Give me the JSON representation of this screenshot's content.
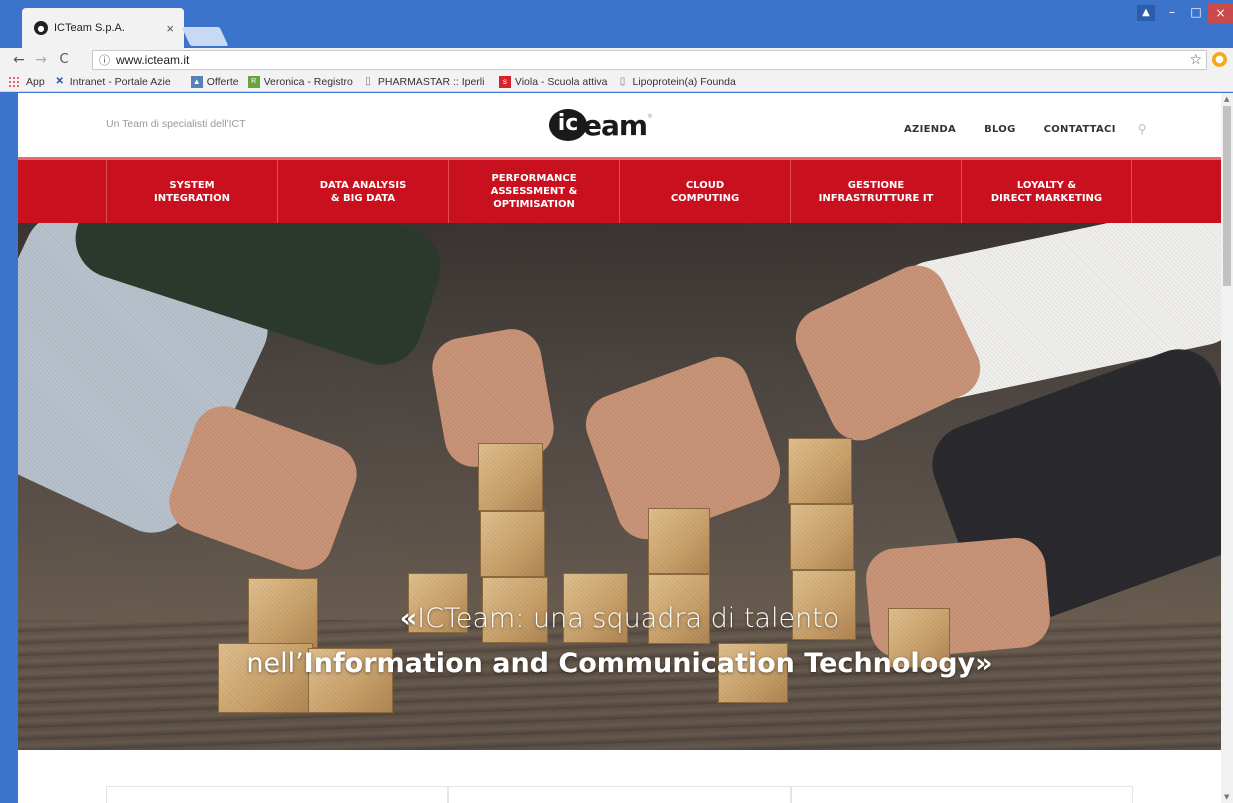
{
  "browser": {
    "tab_title": "ICTeam S.p.A.",
    "tab_close": "×",
    "url": "www.icteam.it",
    "controls": {
      "user": "▲",
      "minimize": "–",
      "maximize": "□",
      "close": "×"
    }
  },
  "bookmarks": [
    {
      "label": "App",
      "icon": "apps-grid-icon"
    },
    {
      "label": "Intranet - Portale Azie",
      "icon": "intranet-x-icon",
      "color": "#1f4ea8"
    },
    {
      "label": "Offerte",
      "icon": "chart-icon",
      "color": "#5b7fb7"
    },
    {
      "label": "Veronica - Registro",
      "icon": "registro-icon",
      "color": "#6aa53c"
    },
    {
      "label": "PHARMASTAR :: Iperli",
      "icon": "page-icon"
    },
    {
      "label": "Viola - Scuola attiva",
      "icon": "scuola-icon",
      "color": "#d6242c"
    },
    {
      "label": "Lipoprotein(a) Founda",
      "icon": "page-icon"
    }
  ],
  "site": {
    "tagline": "Un Team di specialisti dell'ICT",
    "logo": {
      "ic": "ic",
      "word": "eam",
      "reg": "®"
    },
    "topnav": [
      "AZIENDA",
      "BLOG",
      "CONTATTACI"
    ],
    "mainnav": [
      "SYSTEM\nINTEGRATION",
      "DATA ANALYSIS\n& BIG DATA",
      "PERFORMANCE\nASSESSMENT &\nOPTIMISATION",
      "CLOUD\nCOMPUTING",
      "GESTIONE\nINFRASTRUTTURE IT",
      "LOYALTY &\nDIRECT MARKETING"
    ],
    "hero": {
      "open_quote": "«",
      "line1": "ICTeam: una squadra di talento",
      "line2_prefix": "nell’",
      "line2_bold": "Information and Communication Technology",
      "close_quote": "»"
    }
  },
  "colors": {
    "chrome": "#3c74cc",
    "brand_red": "#c8101e"
  }
}
